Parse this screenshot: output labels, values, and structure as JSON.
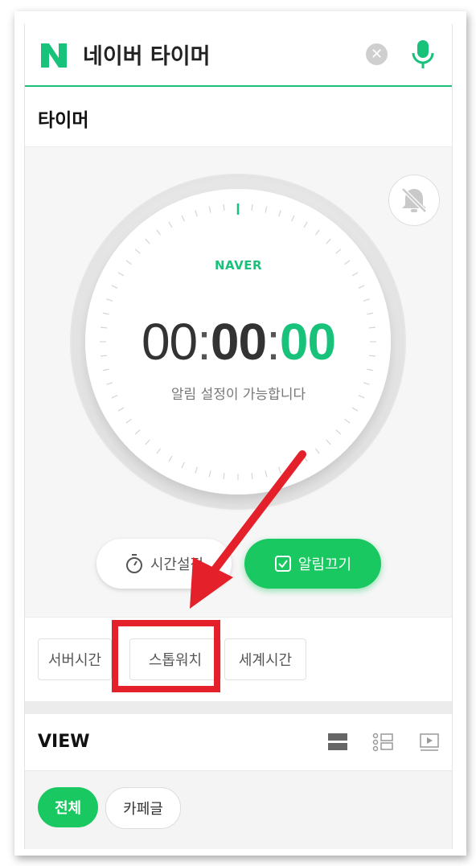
{
  "header": {
    "logo_letter": "N",
    "search_query": "네이버 타이머",
    "clear_icon": "close-icon",
    "mic_icon": "microphone-icon",
    "brand_color": "#19c27a"
  },
  "page": {
    "title": "타이머"
  },
  "timer": {
    "brand": "NAVER",
    "hours": "00",
    "minutes": "00",
    "seconds": "00",
    "hint": "알림 설정이 가능합니다",
    "set_time_label": "시간설정",
    "alarm_off_label": "알림끄기",
    "accent": "#19c860"
  },
  "tabs": {
    "server_time": "서버시간",
    "stopwatch": "스톱워치",
    "world_time": "세계시간"
  },
  "view": {
    "title": "VIEW",
    "filters": [
      "전체",
      "카페글"
    ]
  },
  "annotation": {
    "highlight_color": "#e4202a"
  }
}
